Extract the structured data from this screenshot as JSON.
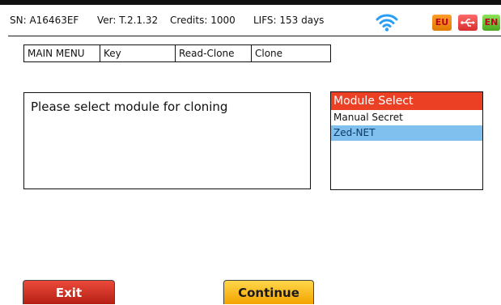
{
  "status": {
    "serial": "SN: A16463EF",
    "version": "Ver: T.2.1.32",
    "credits": "Credits: 1000",
    "lifs": "LIFS: 153 days",
    "region": "EU",
    "language": "EN",
    "icons": [
      "wifi-icon",
      "usb-icon"
    ]
  },
  "menu": {
    "items": [
      "MAIN MENU",
      "Key",
      "Read-Clone",
      "Clone"
    ]
  },
  "message": "Please select module for cloning",
  "module_select": {
    "title": "Module Select",
    "items": [
      "Manual Secret",
      "Zed-NET"
    ],
    "selected": "Zed-NET"
  },
  "buttons": {
    "exit": "Exit",
    "continue": "Continue"
  },
  "colors": {
    "header": "#ec4025",
    "selection": "#7fc0ee",
    "exit": "#d3362a",
    "continue": "#f7b51c"
  }
}
